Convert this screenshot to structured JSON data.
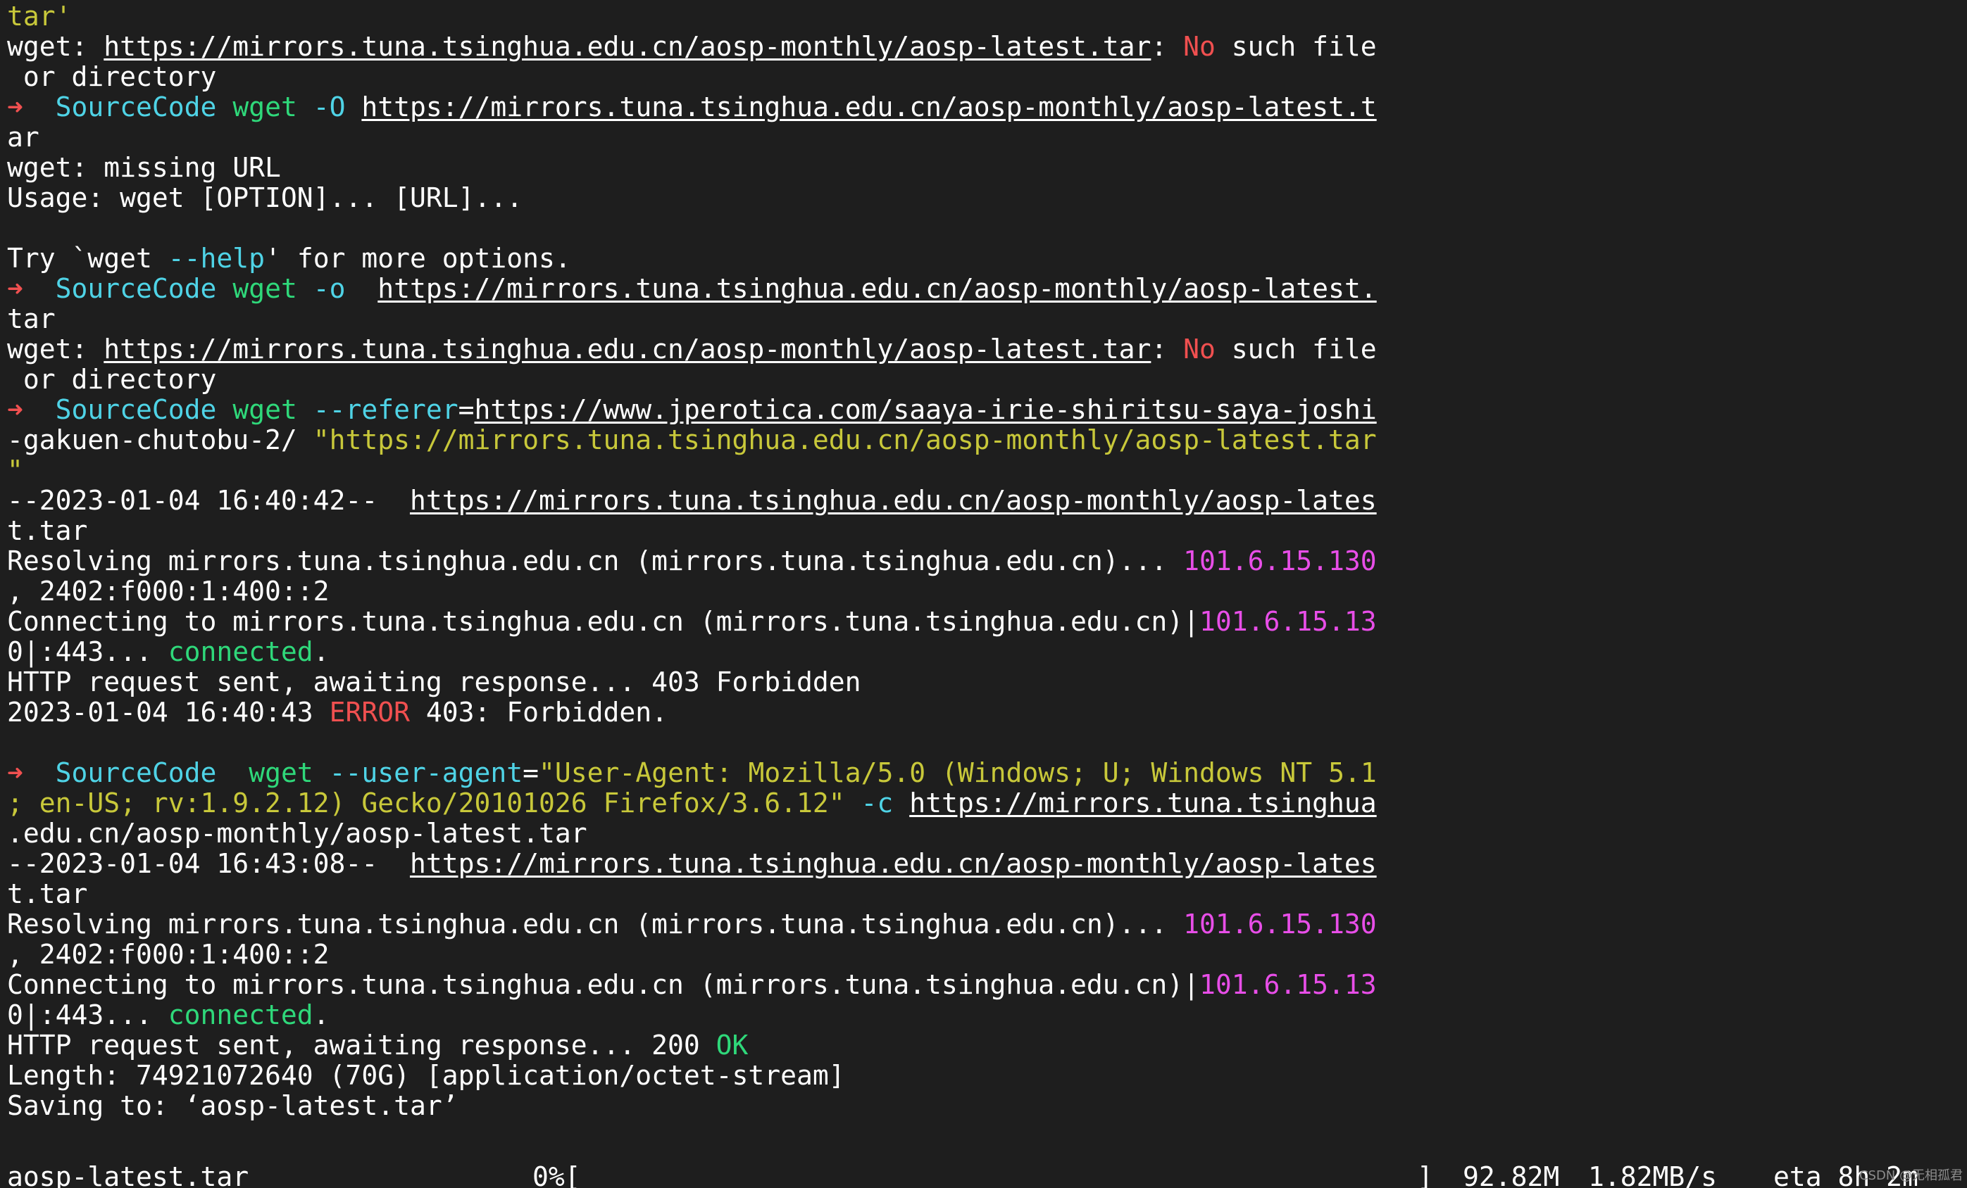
{
  "terminal": {
    "lines": [
      {
        "segments": [
          {
            "t": "tar'",
            "c": "yellow"
          }
        ]
      },
      {
        "segments": [
          {
            "t": "wget: "
          },
          {
            "t": "https://mirrors.tuna.tsinghua.edu.cn/aosp-monthly/aosp-latest.tar",
            "u": true
          },
          {
            "t": ": "
          },
          {
            "t": "No",
            "c": "red"
          },
          {
            "t": " such file"
          }
        ]
      },
      {
        "segments": [
          {
            "t": " or directory"
          }
        ]
      },
      {
        "segments": [
          {
            "t": "➜",
            "c": "red"
          },
          {
            "t": "  "
          },
          {
            "t": "SourceCode",
            "c": "cyan"
          },
          {
            "t": " "
          },
          {
            "t": "wget",
            "c": "green"
          },
          {
            "t": " "
          },
          {
            "t": "-O",
            "c": "cyan"
          },
          {
            "t": " "
          },
          {
            "t": "https://mirrors.tuna.tsinghua.edu.cn/aosp-monthly/aosp-latest.t",
            "u": true
          }
        ]
      },
      {
        "segments": [
          {
            "t": "ar"
          }
        ]
      },
      {
        "segments": [
          {
            "t": "wget: missing URL"
          }
        ]
      },
      {
        "segments": [
          {
            "t": "Usage: wget [OPTION]... [URL]..."
          }
        ]
      },
      {
        "segments": [
          {
            "t": ""
          }
        ]
      },
      {
        "segments": [
          {
            "t": "Try `wget "
          },
          {
            "t": "--help",
            "c": "cyan"
          },
          {
            "t": "' for more options."
          }
        ]
      },
      {
        "segments": [
          {
            "t": "➜",
            "c": "red"
          },
          {
            "t": "  "
          },
          {
            "t": "SourceCode",
            "c": "cyan"
          },
          {
            "t": " "
          },
          {
            "t": "wget",
            "c": "green"
          },
          {
            "t": " "
          },
          {
            "t": "-o",
            "c": "cyan"
          },
          {
            "t": "  "
          },
          {
            "t": "https://mirrors.tuna.tsinghua.edu.cn/aosp-monthly/aosp-latest.",
            "u": true
          }
        ]
      },
      {
        "segments": [
          {
            "t": "tar"
          }
        ]
      },
      {
        "segments": [
          {
            "t": "wget: "
          },
          {
            "t": "https://mirrors.tuna.tsinghua.edu.cn/aosp-monthly/aosp-latest.tar",
            "u": true
          },
          {
            "t": ": "
          },
          {
            "t": "No",
            "c": "red"
          },
          {
            "t": " such file"
          }
        ]
      },
      {
        "segments": [
          {
            "t": " or directory"
          }
        ]
      },
      {
        "segments": [
          {
            "t": "➜",
            "c": "red"
          },
          {
            "t": "  "
          },
          {
            "t": "SourceCode",
            "c": "cyan"
          },
          {
            "t": " "
          },
          {
            "t": "wget",
            "c": "green"
          },
          {
            "t": " "
          },
          {
            "t": "--referer",
            "c": "cyan"
          },
          {
            "t": "="
          },
          {
            "t": "https://www.jperotica.com/saaya-irie-shiritsu-saya-joshi",
            "u": true
          }
        ]
      },
      {
        "segments": [
          {
            "t": "-gakuen-chutobu-2/ "
          },
          {
            "t": "\"https://mirrors.tuna.tsinghua.edu.cn/aosp-monthly/aosp-latest.tar",
            "c": "yellow"
          }
        ]
      },
      {
        "segments": [
          {
            "t": "\"",
            "c": "yellow"
          }
        ]
      },
      {
        "segments": [
          {
            "t": "--2023-01-04 16:40:42--  "
          },
          {
            "t": "https://mirrors.tuna.tsinghua.edu.cn/aosp-monthly/aosp-lates",
            "u": true
          }
        ]
      },
      {
        "segments": [
          {
            "t": "t.tar"
          }
        ]
      },
      {
        "segments": [
          {
            "t": "Resolving mirrors.tuna.tsinghua.edu.cn (mirrors.tuna.tsinghua.edu.cn)... "
          },
          {
            "t": "101.6.15.130",
            "c": "magenta"
          }
        ]
      },
      {
        "segments": [
          {
            "t": ", 2402:f000:1:400::2"
          }
        ]
      },
      {
        "segments": [
          {
            "t": "Connecting to mirrors.tuna.tsinghua.edu.cn (mirrors.tuna.tsinghua.edu.cn)|"
          },
          {
            "t": "101.6.15.13",
            "c": "magenta"
          }
        ]
      },
      {
        "segments": [
          {
            "t": "0|:443... "
          },
          {
            "t": "connected",
            "c": "green"
          },
          {
            "t": "."
          }
        ]
      },
      {
        "segments": [
          {
            "t": "HTTP request sent, awaiting response... 403 Forbidden"
          }
        ]
      },
      {
        "segments": [
          {
            "t": "2023-01-04 16:40:43 "
          },
          {
            "t": "ERROR",
            "c": "red"
          },
          {
            "t": " 403: Forbidden."
          }
        ]
      },
      {
        "segments": [
          {
            "t": ""
          }
        ]
      },
      {
        "segments": [
          {
            "t": "➜",
            "c": "red"
          },
          {
            "t": "  "
          },
          {
            "t": "SourceCode",
            "c": "cyan"
          },
          {
            "t": "  "
          },
          {
            "t": "wget",
            "c": "green"
          },
          {
            "t": " "
          },
          {
            "t": "--user-agent",
            "c": "cyan"
          },
          {
            "t": "="
          },
          {
            "t": "\"User-Agent: Mozilla/5.0 (Windows; U; Windows NT 5.1",
            "c": "yellow"
          }
        ]
      },
      {
        "segments": [
          {
            "t": "; en-US; rv:1.9.2.12) Gecko/20101026 Firefox/3.6.12\"",
            "c": "yellow"
          },
          {
            "t": " "
          },
          {
            "t": "-c",
            "c": "cyan"
          },
          {
            "t": " "
          },
          {
            "t": "https://mirrors.tuna.tsinghua",
            "u": true
          }
        ]
      },
      {
        "segments": [
          {
            "t": ".edu.cn/aosp-monthly/aosp-latest.tar"
          }
        ]
      },
      {
        "segments": [
          {
            "t": "--2023-01-04 16:43:08--  "
          },
          {
            "t": "https://mirrors.tuna.tsinghua.edu.cn/aosp-monthly/aosp-lates",
            "u": true
          }
        ]
      },
      {
        "segments": [
          {
            "t": "t.tar"
          }
        ]
      },
      {
        "segments": [
          {
            "t": "Resolving mirrors.tuna.tsinghua.edu.cn (mirrors.tuna.tsinghua.edu.cn)... "
          },
          {
            "t": "101.6.15.130",
            "c": "magenta"
          }
        ]
      },
      {
        "segments": [
          {
            "t": ", 2402:f000:1:400::2"
          }
        ]
      },
      {
        "segments": [
          {
            "t": "Connecting to mirrors.tuna.tsinghua.edu.cn (mirrors.tuna.tsinghua.edu.cn)|"
          },
          {
            "t": "101.6.15.13",
            "c": "magenta"
          }
        ]
      },
      {
        "segments": [
          {
            "t": "0|:443... "
          },
          {
            "t": "connected",
            "c": "green"
          },
          {
            "t": "."
          }
        ]
      },
      {
        "segments": [
          {
            "t": "HTTP request sent, awaiting response... 200 "
          },
          {
            "t": "OK",
            "c": "green"
          }
        ]
      },
      {
        "segments": [
          {
            "t": "Length: 74921072640 (70G) [application/octet-stream]"
          }
        ]
      },
      {
        "segments": [
          {
            "t": "Saving to: ‘aosp-latest.tar’"
          }
        ]
      },
      {
        "segments": [
          {
            "t": ""
          }
        ]
      }
    ],
    "progress": {
      "filename": "aosp-latest.tar",
      "percent_label": "0%[",
      "bar_end": "]",
      "downloaded": "92.82M",
      "speed": "1.82MB/s",
      "eta": "eta 8h 2m"
    }
  },
  "watermark": "CSDN @无相孤君",
  "colors": {
    "background": "#1e1e1e",
    "text": "#ffffff",
    "red": "#f05050",
    "cyan": "#4fd3e6",
    "green": "#2fd87a",
    "yellow": "#c8c83a",
    "magenta": "#e84ee8"
  }
}
